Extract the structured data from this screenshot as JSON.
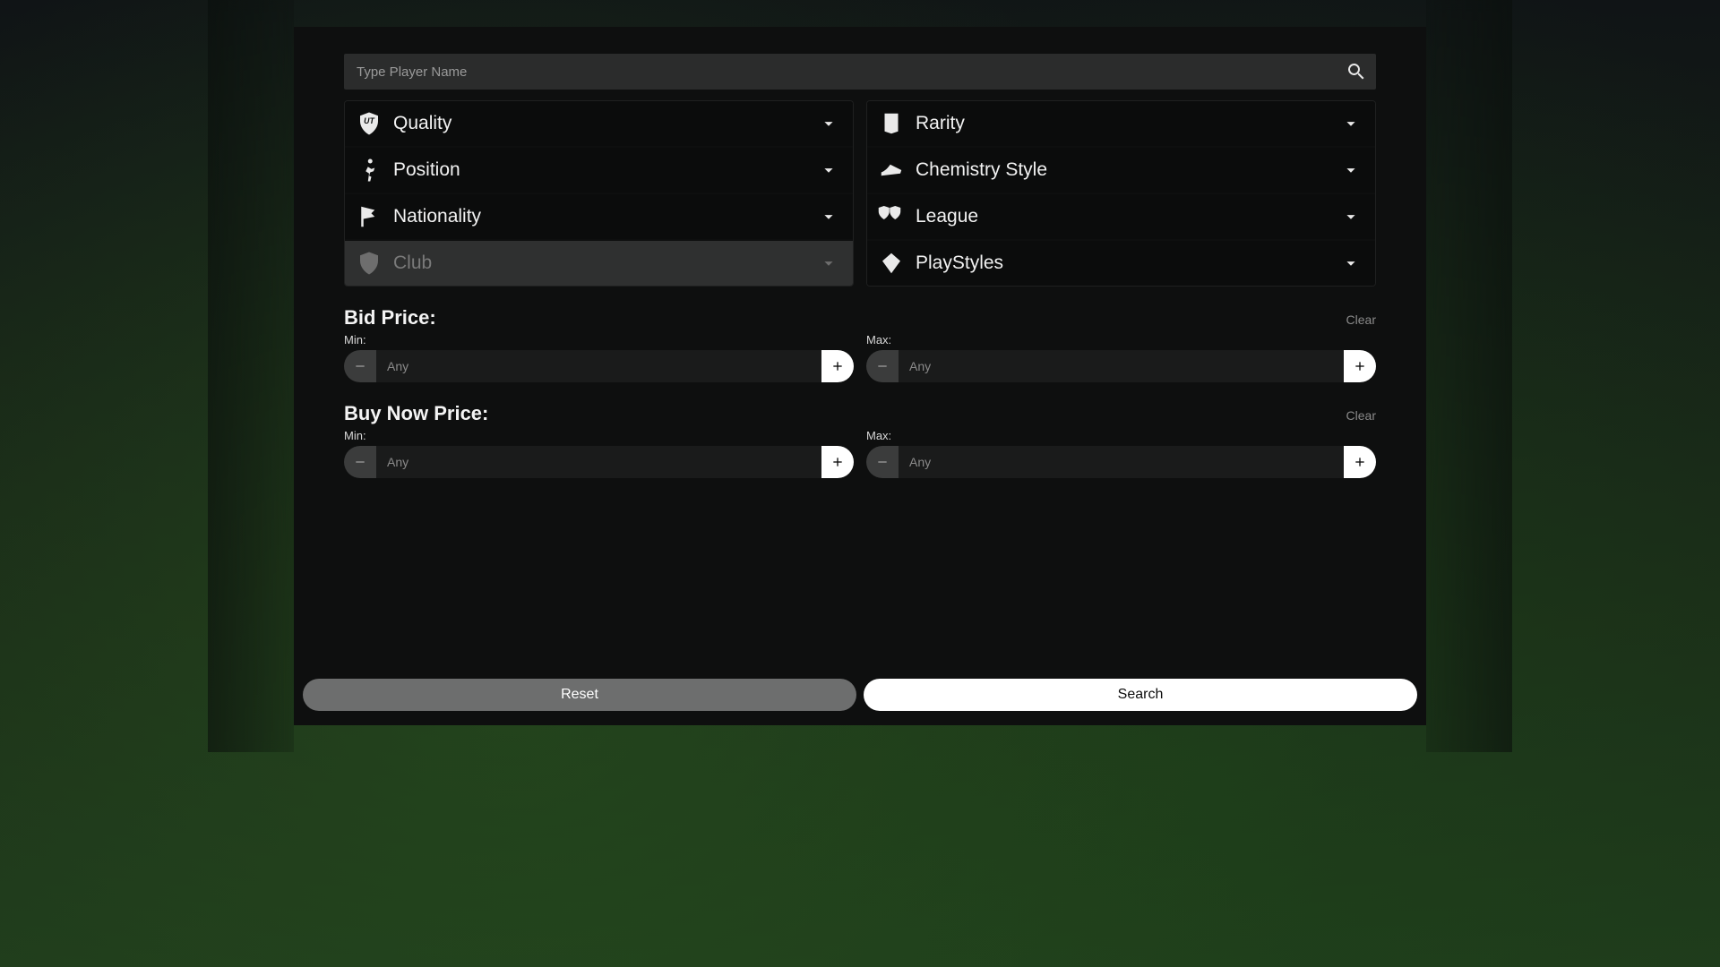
{
  "search": {
    "placeholder": "Type Player Name"
  },
  "filters": {
    "left": [
      {
        "key": "quality",
        "label": "Quality",
        "icon": "shield-ut",
        "disabled": false
      },
      {
        "key": "position",
        "label": "Position",
        "icon": "runner",
        "disabled": false
      },
      {
        "key": "nationality",
        "label": "Nationality",
        "icon": "flag",
        "disabled": false
      },
      {
        "key": "club",
        "label": "Club",
        "icon": "shield",
        "disabled": true
      }
    ],
    "right": [
      {
        "key": "rarity",
        "label": "Rarity",
        "icon": "card",
        "disabled": false
      },
      {
        "key": "chemstyle",
        "label": "Chemistry Style",
        "icon": "boot",
        "disabled": false
      },
      {
        "key": "league",
        "label": "League",
        "icon": "twoshields",
        "disabled": false
      },
      {
        "key": "playstyles",
        "label": "PlayStyles",
        "icon": "diamond",
        "disabled": false
      }
    ]
  },
  "price": {
    "bid": {
      "title": "Bid Price:",
      "clear": "Clear",
      "min_label": "Min:",
      "max_label": "Max:",
      "placeholder": "Any"
    },
    "buy": {
      "title": "Buy Now Price:",
      "clear": "Clear",
      "min_label": "Min:",
      "max_label": "Max:",
      "placeholder": "Any"
    }
  },
  "footer": {
    "reset": "Reset",
    "search": "Search"
  }
}
